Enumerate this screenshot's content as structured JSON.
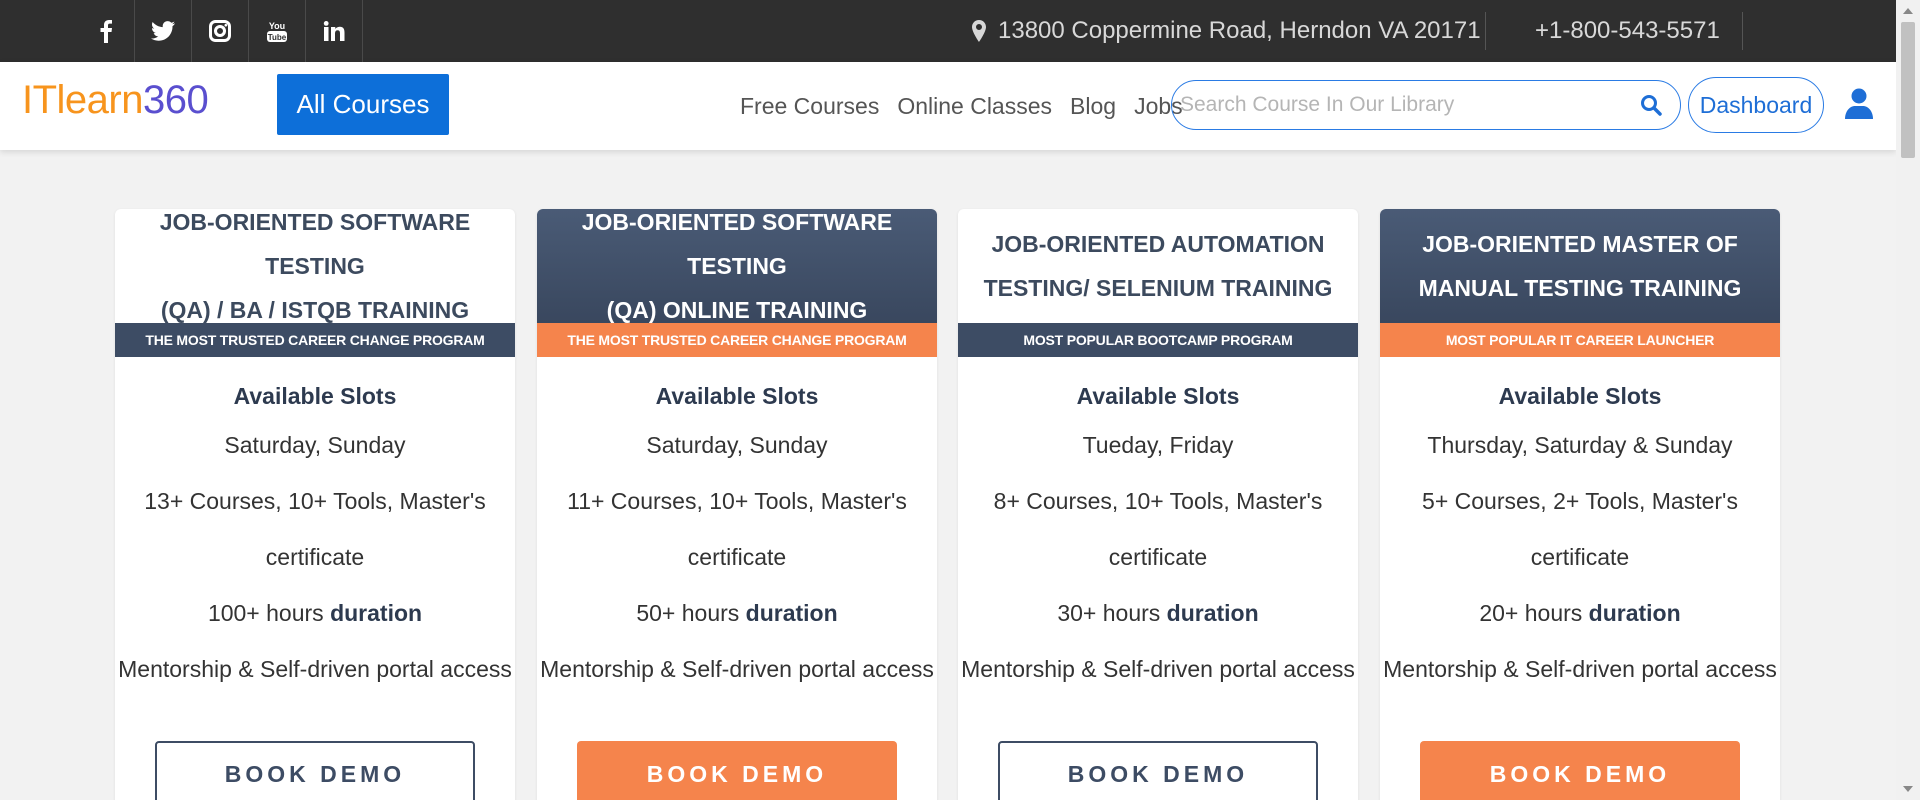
{
  "topbar": {
    "social_icons": [
      {
        "name": "facebook-icon",
        "glyph": "f"
      },
      {
        "name": "twitter-icon",
        "glyph": "🐦"
      },
      {
        "name": "instagram-icon",
        "glyph": "◎"
      },
      {
        "name": "youtube-icon",
        "glyph": "You Tube"
      },
      {
        "name": "linkedin-icon",
        "glyph": "in"
      }
    ],
    "address": "13800 Coppermine Road, Herndon VA 20171",
    "phone": "+1-800-543-5571"
  },
  "nav": {
    "logo_part1": "ITlearn",
    "logo_part2": "360",
    "all_courses": "All Courses",
    "links": [
      "Free Courses",
      "Online Classes",
      "Blog",
      "Jobs"
    ],
    "search_placeholder": "Search Course In Our Library",
    "dashboard": "Dashboard"
  },
  "colors": {
    "accent_blue": "#0d6fd9",
    "navy": "#3d4c64",
    "orange": "#f5844c",
    "logo_orange": "#f7941d",
    "logo_purple": "#5a4fcf"
  },
  "cards": [
    {
      "title_line1": "JOB-ORIENTED SOFTWARE TESTING",
      "title_line2": "(QA) / BA / ISTQB TRAINING",
      "band": "THE MOST TRUSTED CAREER CHANGE PROGRAM",
      "slots_label": "Available Slots",
      "days": "Saturday, Sunday",
      "courses_line1": "13+ Courses, 10+ Tools, Master's",
      "courses_line2": "certificate",
      "hours": "100+ hours",
      "duration_label": "duration",
      "access": "Mentorship & Self-driven portal access",
      "cta": "BOOK DEMO"
    },
    {
      "title_line1": "JOB-ORIENTED SOFTWARE TESTING",
      "title_line2": "(QA) ONLINE TRAINING",
      "band": "THE MOST TRUSTED CAREER CHANGE PROGRAM",
      "slots_label": "Available Slots",
      "days": "Saturday, Sunday",
      "courses_line1": "11+ Courses, 10+ Tools, Master's",
      "courses_line2": "certificate",
      "hours": "50+ hours",
      "duration_label": "duration",
      "access": "Mentorship & Self-driven portal access",
      "cta": "BOOK DEMO"
    },
    {
      "title_line1": "JOB-ORIENTED AUTOMATION",
      "title_line2": "TESTING/ SELENIUM TRAINING",
      "band": "MOST POPULAR BOOTCAMP PROGRAM",
      "slots_label": "Available Slots",
      "days": "Tueday, Friday",
      "courses_line1": "8+ Courses, 10+ Tools, Master's",
      "courses_line2": "certificate",
      "hours": "30+ hours",
      "duration_label": "duration",
      "access": "Mentorship & Self-driven portal access",
      "cta": "BOOK DEMO"
    },
    {
      "title_line1": "JOB-ORIENTED MASTER OF",
      "title_line2": "MANUAL TESTING TRAINING",
      "band": "MOST POPULAR IT CAREER LAUNCHER",
      "slots_label": "Available Slots",
      "days": "Thursday, Saturday & Sunday",
      "courses_line1": "5+ Courses, 2+ Tools, Master's",
      "courses_line2": "certificate",
      "hours": "20+ hours",
      "duration_label": "duration",
      "access": "Mentorship & Self-driven portal access",
      "cta": "BOOK DEMO"
    }
  ]
}
